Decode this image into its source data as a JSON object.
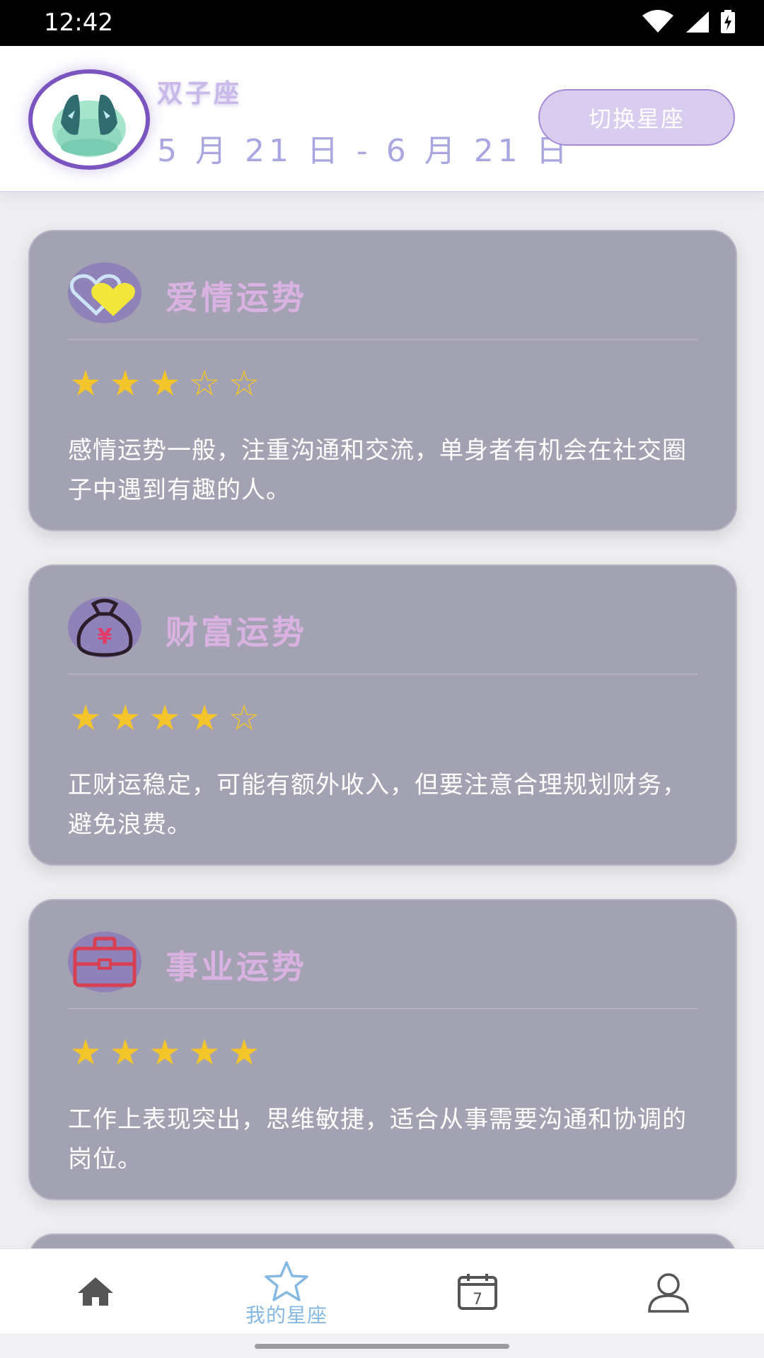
{
  "status_bar": {
    "time": "12:42"
  },
  "header": {
    "sign_name": "双子座",
    "date_range": "5 月 21 日 - 6 月 21 日",
    "switch_label": "切换星座"
  },
  "cards": [
    {
      "icon": "hearts-icon",
      "title": "爱情运势",
      "rating": 3,
      "max_rating": 5,
      "stars": [
        "★",
        "★",
        "★",
        "☆",
        "☆"
      ],
      "description": "感情运势一般，注重沟通和交流，单身者有机会在社交圈子中遇到有趣的人。"
    },
    {
      "icon": "money-bag-icon",
      "title": "财富运势",
      "rating": 4,
      "max_rating": 5,
      "stars": [
        "★",
        "★",
        "★",
        "★",
        "☆"
      ],
      "description": "正财运稳定，可能有额外收入，但要注意合理规划财务，避免浪费。"
    },
    {
      "icon": "briefcase-icon",
      "title": "事业运势",
      "rating": 5,
      "max_rating": 5,
      "stars": [
        "★",
        "★",
        "★",
        "★",
        "★"
      ],
      "description": "工作上表现突出，思维敏捷，适合从事需要沟通和协调的岗位。"
    }
  ],
  "bottom_nav": {
    "items": [
      {
        "icon": "home-icon",
        "label": ""
      },
      {
        "icon": "star-icon",
        "label": "我的星座",
        "active": true
      },
      {
        "icon": "calendar-icon",
        "label": "",
        "badge": "7"
      },
      {
        "icon": "user-icon",
        "label": ""
      }
    ]
  },
  "colors": {
    "accent": "#7a55c0",
    "card_bg": "#a3a2b2",
    "star": "#f4c52a",
    "nav_active": "#86b9e2"
  }
}
